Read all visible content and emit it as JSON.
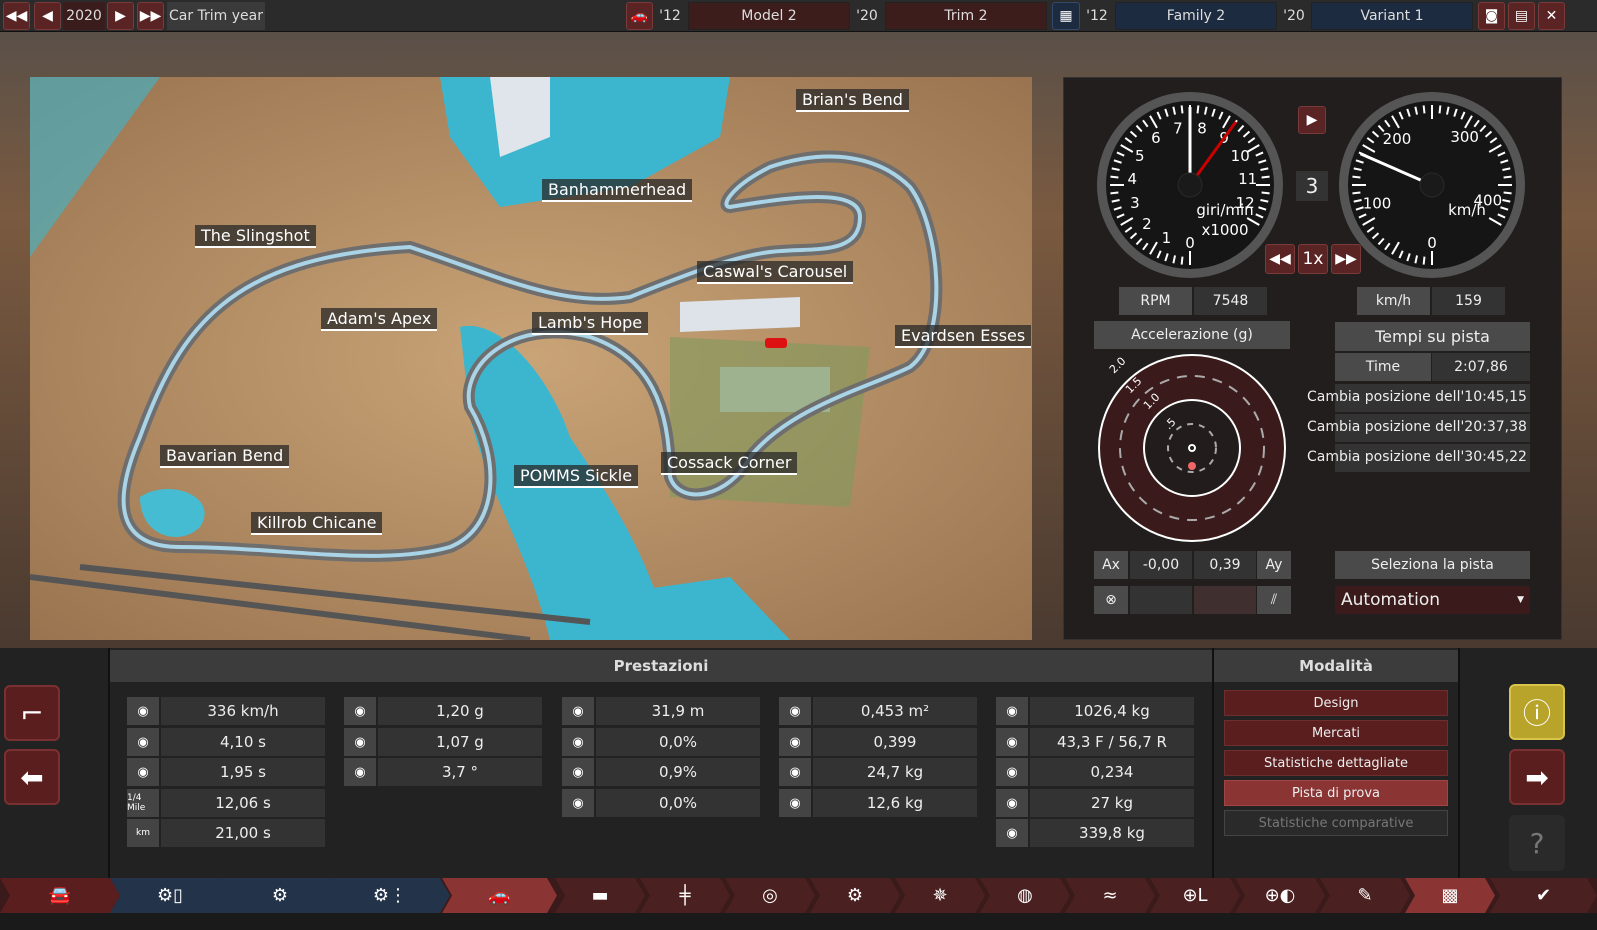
{
  "topbar": {
    "year": "2020",
    "car_trim_year_label": "Car Trim year",
    "model_year": "'12",
    "model": "Model 2",
    "trim_year": "'20",
    "trim": "Trim 2",
    "family_year": "'12",
    "family": "Family 2",
    "variant_year": "'20",
    "variant": "Variant 1"
  },
  "map": {
    "labels": [
      "Brian's Bend",
      "Banhammerhead",
      "The Slingshot",
      "Caswal's Carousel",
      "Adam's Apex",
      "Lamb's Hope",
      "Evardsen Esses",
      "Bavarian Bend",
      "POMMS Sickle",
      "Cossack Corner",
      "Killrob Chicane"
    ]
  },
  "gauges": {
    "rpm_ticks": [
      "0",
      "1",
      "2",
      "3",
      "4",
      "5",
      "6",
      "7",
      "8",
      "9",
      "10",
      "11",
      "12"
    ],
    "rpm_unit": "giri/min",
    "rpm_mult": "x1000",
    "speed_ticks": [
      "0",
      "100",
      "200",
      "300",
      "400"
    ],
    "speed_unit": "km/h",
    "gear": "3",
    "playback_speed": "1x",
    "rpm_needle_value": 7.5,
    "rpm_redline": 9,
    "speed_needle_value": 159
  },
  "readouts": {
    "rpm_label": "RPM",
    "rpm_value": "7548",
    "speed_label": "km/h",
    "speed_value": "159"
  },
  "accel": {
    "title": "Accelerazione (g)",
    "rings": [
      "2.0",
      "1.5",
      "1.0",
      ".5"
    ],
    "ax_label": "Ax",
    "ax_value": "-0,00",
    "ay_value": "0,39",
    "ay_label": "Ay"
  },
  "laptimes": {
    "title": "Tempi su pista",
    "time_label": "Time",
    "time_value": "2:07,86",
    "laps": [
      "Cambia posizione dell'10:45,15",
      "Cambia posizione dell'20:37,38",
      "Cambia posizione dell'30:45,22"
    ],
    "select_track": "Seleziona la pista",
    "track": "Automation"
  },
  "performance": {
    "title": "Prestazioni",
    "columns": [
      [
        {
          "icon": "top-speed",
          "value": "336 km/h"
        },
        {
          "icon": "0-100",
          "value": "4,10 s"
        },
        {
          "icon": "80-120",
          "value": "1,95 s"
        },
        {
          "icon": "quarter-mile",
          "icon_text": "1/4 Mile",
          "value": "12,06 s"
        },
        {
          "icon": "km",
          "icon_text": "km",
          "value": "21,00 s"
        }
      ],
      [
        {
          "icon": "lateral-g-low",
          "value": "1,20 g"
        },
        {
          "icon": "lateral-g-high",
          "value": "1,07 g"
        },
        {
          "icon": "body-roll",
          "value": "3,7 °"
        }
      ],
      [
        {
          "icon": "braking-distance",
          "value": "31,9 m"
        },
        {
          "icon": "brake-fade-steer",
          "value": "0,0%"
        },
        {
          "icon": "brake-fade-race",
          "value": "0,9%"
        },
        {
          "icon": "brake-fade-offroad",
          "value": "0,0%"
        }
      ],
      [
        {
          "icon": "frontal-area",
          "value": "0,453 m²"
        },
        {
          "icon": "drag-coefficient",
          "value": "0,399"
        },
        {
          "icon": "front-downforce",
          "value": "24,7 kg"
        },
        {
          "icon": "rear-downforce",
          "value": "12,6 kg"
        }
      ],
      [
        {
          "icon": "weight",
          "value": "1026,4 kg"
        },
        {
          "icon": "weight-distribution",
          "value": "43,3 F / 56,7 R"
        },
        {
          "icon": "torsion",
          "value": "0,234"
        },
        {
          "icon": "tow-weight",
          "value": "27 kg"
        },
        {
          "icon": "cargo",
          "value": "339,8 kg"
        }
      ]
    ]
  },
  "modes": {
    "title": "Modalità",
    "items": [
      "Design",
      "Mercati",
      "Statistiche dettagliate",
      "Pista di prova",
      "Statistiche comparative"
    ],
    "active": 3
  },
  "colors": {
    "accent_red": "#5a1e1e",
    "active_red": "#8a3434",
    "nav_blue": "#233349",
    "warning": "#b8a42a"
  }
}
